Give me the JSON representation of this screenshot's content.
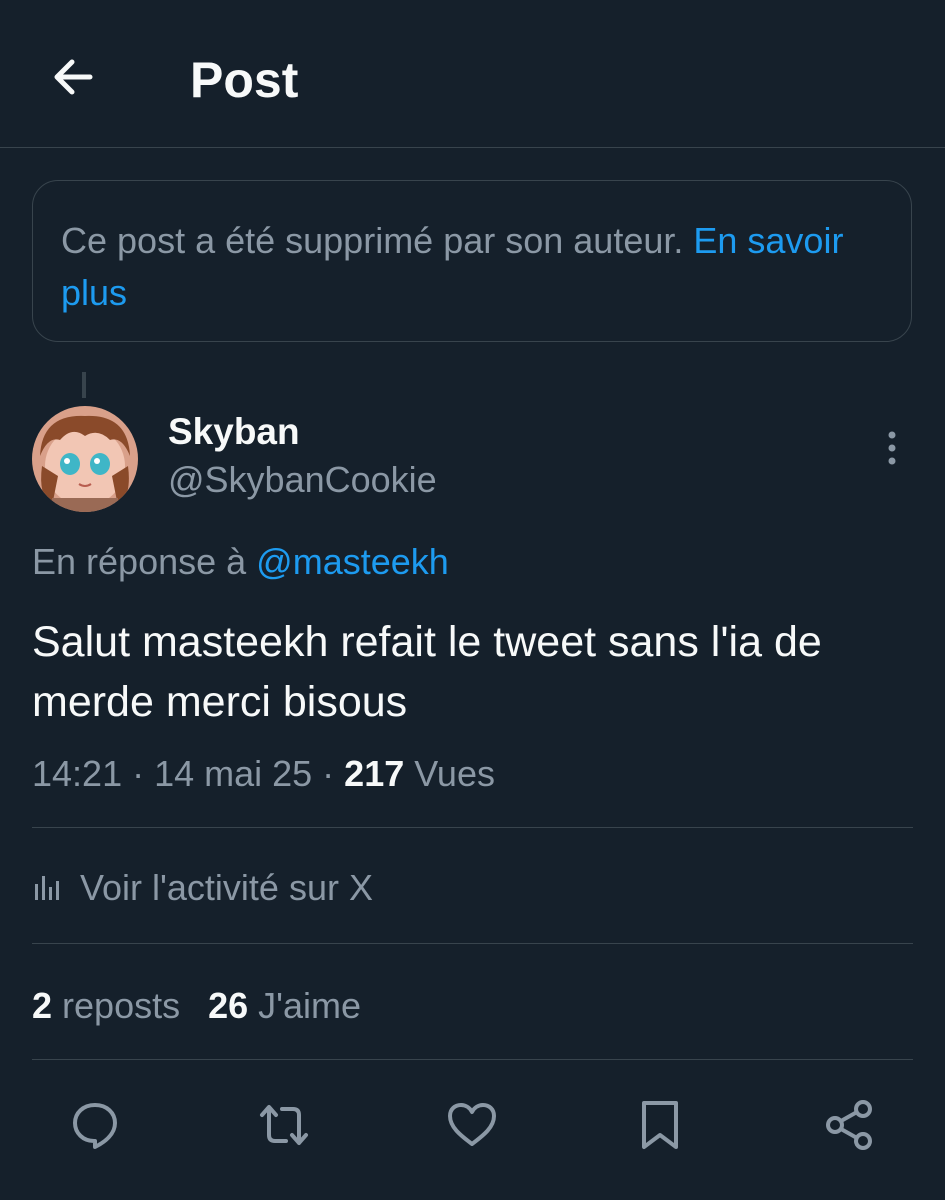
{
  "header": {
    "title": "Post",
    "back_icon": "arrow-left-icon"
  },
  "notice": {
    "text": "Ce post a été supprimé par son auteur. ",
    "link": "En savoir plus"
  },
  "post": {
    "author_name": "Skyban",
    "author_handle": "@SkybanCookie",
    "reply_prefix": "En réponse à ",
    "reply_to": "@masteekh",
    "text": "Salut masteekh refait le tweet sans l'ia de merde merci bisous",
    "time": "14:21 · 14 mai 25 · ",
    "views_count": "217",
    "views_label": " Vues"
  },
  "activity": {
    "label": "Voir l'activité sur X",
    "icon": "analytics-icon"
  },
  "stats": {
    "reposts_count": "2",
    "reposts_label": " reposts",
    "likes_count": "26",
    "likes_label": " J'aime"
  },
  "actions": [
    "reply-icon",
    "repost-icon",
    "like-icon",
    "bookmark-icon",
    "share-icon"
  ],
  "colors": {
    "background": "#15202b",
    "accent": "#1d9bf0",
    "muted": "#8b98a5",
    "border": "#38444d",
    "text": "#f7f9f9"
  }
}
